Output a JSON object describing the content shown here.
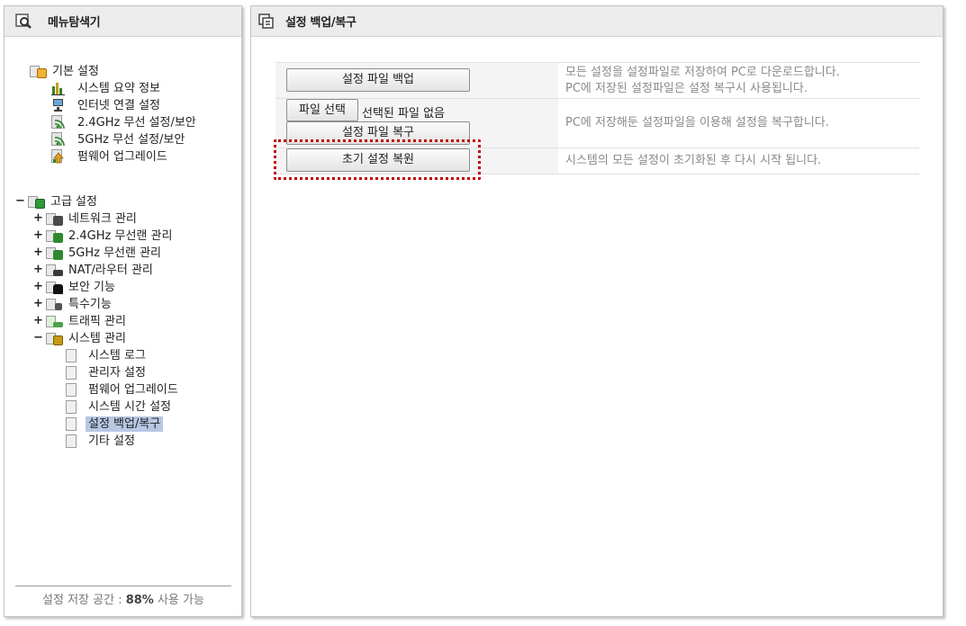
{
  "left_panel": {
    "title": "메뉴탐색기",
    "basic": {
      "label": "기본 설정",
      "items": [
        {
          "label": "시스템 요약 정보",
          "icon": "bar-chart-icon"
        },
        {
          "label": "인터넷 연결 설정",
          "icon": "network-computer-icon"
        },
        {
          "label": "2.4GHz 무선 설정/보안",
          "icon": "wireless-icon"
        },
        {
          "label": "5GHz 무선 설정/보안",
          "icon": "wireless-icon"
        },
        {
          "label": "펌웨어 업그레이드",
          "icon": "upgrade-icon"
        }
      ]
    },
    "advanced": {
      "label": "고급 설정",
      "expander": "−",
      "items": [
        {
          "label": "네트워크 관리",
          "expander": "+",
          "icon": "network-icon"
        },
        {
          "label": "2.4GHz 무선랜 관리",
          "expander": "+",
          "icon": "wireless-icon"
        },
        {
          "label": "5GHz 무선랜 관리",
          "expander": "+",
          "icon": "wireless-icon"
        },
        {
          "label": "NAT/라우터 관리",
          "expander": "+",
          "icon": "router-icon"
        },
        {
          "label": "보안 기능",
          "expander": "+",
          "icon": "lock-icon"
        },
        {
          "label": "특수기능",
          "expander": "+",
          "icon": "special-icon"
        },
        {
          "label": "트래픽 관리",
          "expander": "+",
          "icon": "traffic-icon"
        },
        {
          "label": "시스템 관리",
          "expander": "−",
          "icon": "system-icon"
        }
      ],
      "system_children": [
        {
          "label": "시스템 로그"
        },
        {
          "label": "관리자 설정"
        },
        {
          "label": "펌웨어 업그레이드"
        },
        {
          "label": "시스템 시간 설정"
        },
        {
          "label": "설정 백업/복구",
          "selected": true
        },
        {
          "label": "기타 설정"
        }
      ]
    },
    "storage": {
      "prefix": "설정 저장 공간 : ",
      "percent": "88%",
      "suffix": " 사용 가능"
    }
  },
  "right_panel": {
    "title": "설정 백업/복구",
    "rows": [
      {
        "button": "설정 파일 백업",
        "desc_line1": "모든 설정을 설정파일로 저장하여 PC로 다운로드합니다.",
        "desc_line2": "PC에 저장된 설정파일은 설정 복구시 사용됩니다."
      },
      {
        "file_button": "파일 선택",
        "file_status": "선택된 파일 없음",
        "button": "설정 파일 복구",
        "desc_line1": "PC에 저장해둔 설정파일을 이용해 설정을 복구합니다."
      },
      {
        "button": "초기 설정 복원",
        "desc_line1": "시스템의 모든 설정이 초기화된 후 다시 시작 됩니다."
      }
    ]
  },
  "colors": {
    "selected_bg": "#b6c8e4",
    "highlight_border": "#c00000",
    "header_bg": "#ececec"
  }
}
